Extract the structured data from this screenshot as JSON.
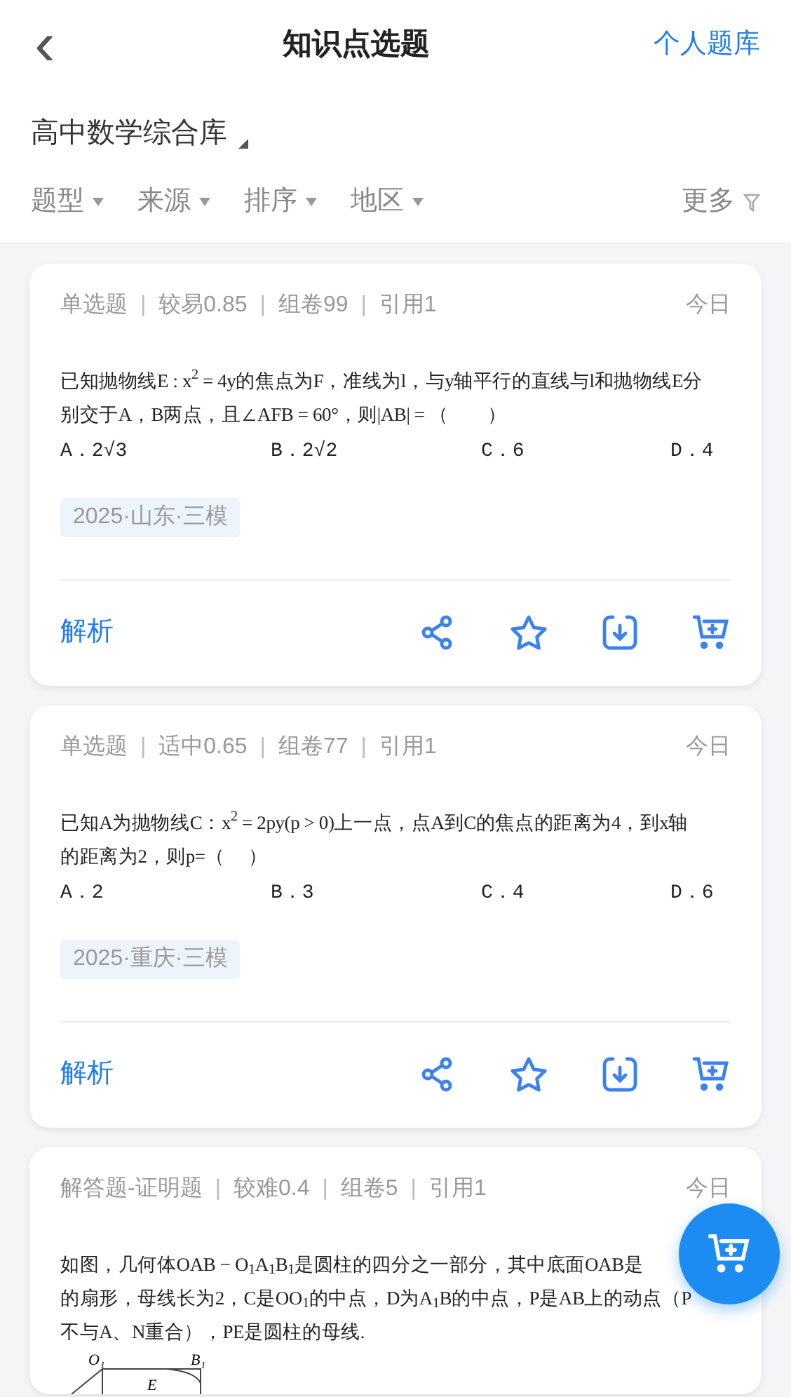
{
  "header": {
    "back": "‹",
    "title": "知识点选题",
    "action": "个人题库"
  },
  "library": {
    "label": "高中数学综合库"
  },
  "filters": [
    {
      "label": "题型",
      "kind": "dropdown"
    },
    {
      "label": "来源",
      "kind": "dropdown"
    },
    {
      "label": "排序",
      "kind": "dropdown"
    },
    {
      "label": "地区",
      "kind": "dropdown"
    },
    {
      "label": "更多",
      "kind": "filter"
    }
  ],
  "questions": [
    {
      "meta": [
        "单选题",
        "较易0.85",
        "组卷99",
        "引用1"
      ],
      "separator": "|",
      "date": "今日",
      "lines": [
        "已知抛物线E : x$^{2}$ = 4y的焦点为F，准线为l，与y轴平行的直线与l和抛物线E分",
        "别交于A，B两点，且∠AFB = 60°，则|AB| = （　　）"
      ],
      "options": [
        "A．2√3",
        "B．2√2",
        "C．6",
        "D．4"
      ],
      "tag": "2025·山东·三模",
      "analysis": "解析"
    },
    {
      "meta": [
        "单选题",
        "适中0.65",
        "组卷77",
        "引用1"
      ],
      "separator": "|",
      "date": "今日",
      "lines": [
        "已知A为抛物线C：x$^{2}$ = 2py(p > 0)上一点，点A到C的焦点的距离为4，到x轴",
        "的距离为2，则p=（　 ）"
      ],
      "options": [
        "A．2",
        "B．3",
        "C．4",
        "D．6"
      ],
      "tag": "2025·重庆·三模",
      "analysis": "解析"
    },
    {
      "meta": [
        "解答题-证明题",
        "较难0.4",
        "组卷5",
        "引用1"
      ],
      "separator": "|",
      "date": "今日",
      "lines": [
        "如图，几何体OAB − O$_{1}$A$_{1}$B$_{1}$是圆柱的四分之一部分，其中底面OAB是",
        "的扇形，母线长为2，C是OO$_{1}$的中点，D为A$_{1}$B的中点，P是AB上的动点（P",
        "不与A、N重合），PE是圆柱的母线."
      ],
      "figure_labels": [
        "O₁",
        "B₁",
        "E"
      ]
    }
  ]
}
